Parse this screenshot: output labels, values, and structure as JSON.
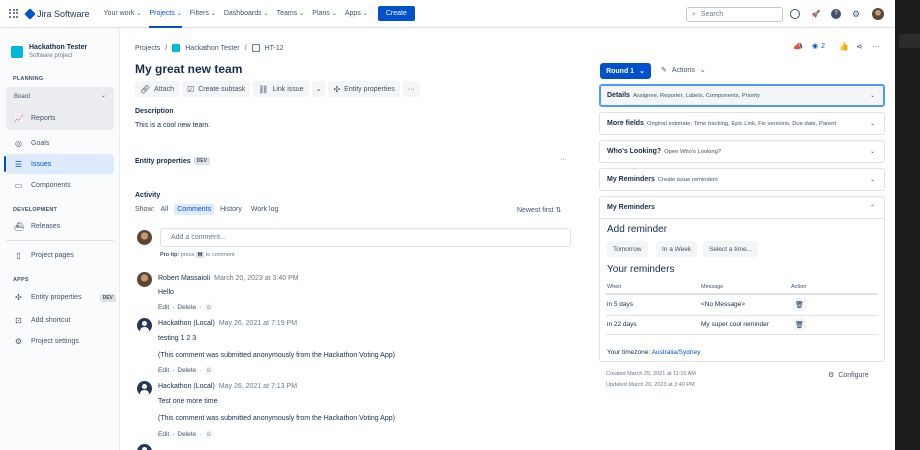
{
  "topnav": {
    "logo_text": "Jira Software",
    "items": [
      {
        "label": "Your work",
        "active": false
      },
      {
        "label": "Projects",
        "active": true
      },
      {
        "label": "Filters",
        "active": false
      },
      {
        "label": "Dashboards",
        "active": false
      },
      {
        "label": "Teams",
        "active": false
      },
      {
        "label": "Plans",
        "active": false
      },
      {
        "label": "Apps",
        "active": false
      }
    ],
    "create_label": "Create",
    "search_placeholder": "Search",
    "brand_color": "#0052cc"
  },
  "sidebar": {
    "project_name": "Hackathon Tester",
    "project_type": "Software project",
    "planning_heading": "PLANNING",
    "board_label": "Board",
    "reports_label": "Reports",
    "goals_label": "Goals",
    "issues_label": "Issues",
    "components_label": "Components",
    "development_heading": "DEVELOPMENT",
    "releases_label": "Releases",
    "project_pages_label": "Project pages",
    "apps_heading": "APPS",
    "entity_properties_label": "Entity properties",
    "entity_dev_badge": "DEV",
    "add_shortcut_label": "Add shortcut",
    "project_settings_label": "Project settings"
  },
  "breadcrumb": {
    "projects": "Projects",
    "sep": "/",
    "project": "Hackathon Tester",
    "issue_key": "HT-12"
  },
  "issue": {
    "title": "My great new team",
    "toolbar": {
      "attach": "Attach",
      "create_subtask": "Create subtask",
      "link_issue": "Link issue",
      "entity_properties": "Entity properties"
    },
    "description_heading": "Description",
    "description_text": "This is a cool new team.",
    "entity_properties_heading": "Entity properties",
    "entity_dev_badge": "DEV",
    "more_label": "···"
  },
  "activity": {
    "heading": "Activity",
    "show_label": "Show:",
    "tabs": [
      {
        "label": "All",
        "active": false
      },
      {
        "label": "Comments",
        "active": true
      },
      {
        "label": "History",
        "active": false
      },
      {
        "label": "Work log",
        "active": false
      }
    ],
    "sort_label": "Newest first",
    "add_comment_placeholder": "Add a comment...",
    "pro_tip_label": "Pro tip:",
    "pro_tip_press": "press",
    "pro_tip_key": "M",
    "pro_tip_suffix": "to comment",
    "edit_label": "Edit",
    "delete_label": "Delete",
    "comments": [
      {
        "author": "Robert Massaioli",
        "date": "March 20, 2023 at 3:40 PM",
        "lines": [
          "Hello"
        ]
      },
      {
        "author": "Hackathon (Local)",
        "date": "May 26, 2021 at 7:19 PM",
        "lines": [
          "testing 1 2 3",
          "(This comment was submitted anonymously from the Hackathon Voting App)"
        ]
      },
      {
        "author": "Hackathon (Local)",
        "date": "May 26, 2021 at 7:13 PM",
        "lines": [
          "Test one more time",
          "(This comment was submitted anonymously from the Hackathon Voting App)"
        ]
      }
    ]
  },
  "right": {
    "round_label": "Round 1",
    "actions_label": "Actions",
    "watch_count": "2",
    "details_title": "Details",
    "details_sub": "Assignee, Reporter, Labels, Components, Priority",
    "more_fields_title": "More fields",
    "more_fields_sub": "Original estimate, Time tracking, Epic Link, Fix versions, Due date, Parent",
    "whos_looking_title": "Who's Looking?",
    "whos_looking_sub": "Open Who's Looking?",
    "my_reminders_title": "My Reminders",
    "my_reminders_sub": "Create issue reminders",
    "reminders_panel_title": "My Reminders",
    "add_reminder_heading": "Add reminder",
    "reminder_buttons": [
      "Tomorrow",
      "In a Week",
      "Select a time..."
    ],
    "your_reminders_heading": "Your reminders",
    "table_headers": {
      "when": "When",
      "message": "Message",
      "action": "Action"
    },
    "reminders": [
      {
        "when": "in 5 days",
        "message": "<No Message>"
      },
      {
        "when": "in 22 days",
        "message": "My super cool reminder"
      }
    ],
    "timezone_label": "Your timezone:",
    "timezone_value": "Australia/Sydney",
    "created": "Created March 25, 2021 at 11:15 AM",
    "updated": "Updated March 20, 2023 at 3:40 PM",
    "configure_label": "Configure"
  }
}
